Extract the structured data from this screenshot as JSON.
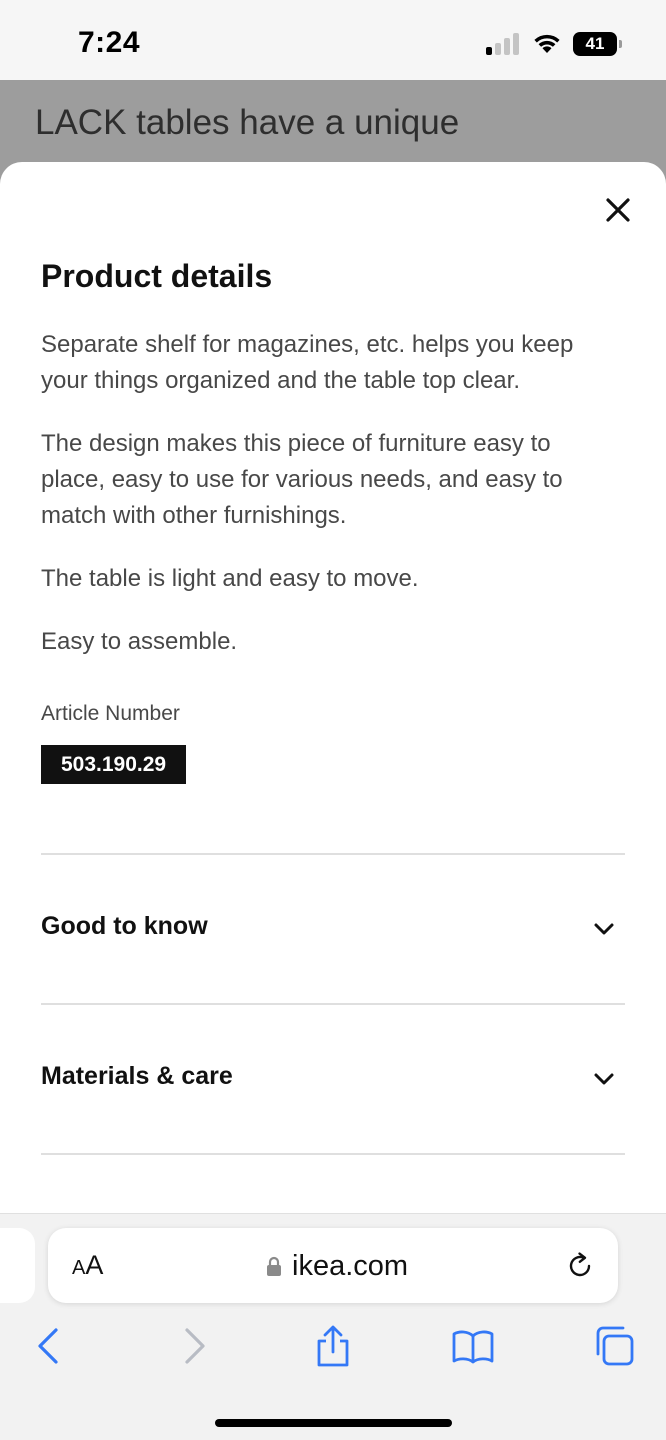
{
  "status_bar": {
    "time": "7:24",
    "battery": "41",
    "icons": [
      "signal-icon",
      "wifi-icon",
      "battery-icon"
    ]
  },
  "background_page": {
    "heading_fragment": "LACK tables have a unique"
  },
  "product_details": {
    "title": "Product details",
    "paragraphs": [
      "Separate shelf for magazines, etc. helps you keep your things organized and the table top clear.",
      "The design makes this piece of furniture easy to place, easy to use for various needs, and easy to match with other furnishings.",
      "The table is light and easy to move.",
      "Easy to assemble."
    ],
    "article_number_label": "Article Number",
    "article_number": "503.190.29",
    "accordion": [
      {
        "label": "Good to know",
        "icon": "chevron-down-icon"
      },
      {
        "label": "Materials & care",
        "icon": "chevron-down-icon"
      }
    ],
    "close_icon": "close-icon"
  },
  "browser": {
    "text_size_small": "A",
    "text_size_big": "A",
    "url": "ikea.com",
    "icons": [
      "lock-icon",
      "reload-icon",
      "back-icon",
      "forward-icon",
      "share-icon",
      "bookmarks-icon",
      "tabs-icon"
    ],
    "accent_color": "#3478f6",
    "disabled_color": "#b8bcc4"
  }
}
